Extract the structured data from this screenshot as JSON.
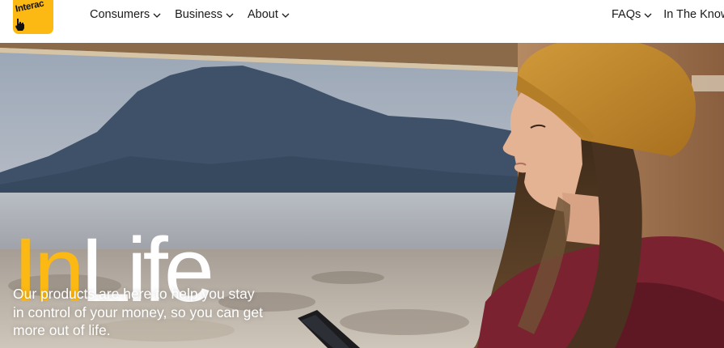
{
  "logo": {
    "text": "Interac",
    "icon": "hand-pointer-icon"
  },
  "nav": {
    "left": [
      {
        "label": "Consumers",
        "icon": "chevron-down-icon"
      },
      {
        "label": "Business",
        "icon": "chevron-down-icon"
      },
      {
        "label": "About",
        "icon": "chevron-down-icon"
      }
    ],
    "right": [
      {
        "label": "FAQs",
        "icon": "chevron-down-icon"
      },
      {
        "label": "In The Know"
      }
    ]
  },
  "hero": {
    "title_highlight": "In",
    "title_rest": "Life",
    "body": "Our products are here to help you stay in control of your money, so you can get more out of life."
  },
  "colors": {
    "brand_yellow": "#fdb913",
    "nav_text": "#1a1a1a",
    "hero_text": "#ffffff"
  }
}
